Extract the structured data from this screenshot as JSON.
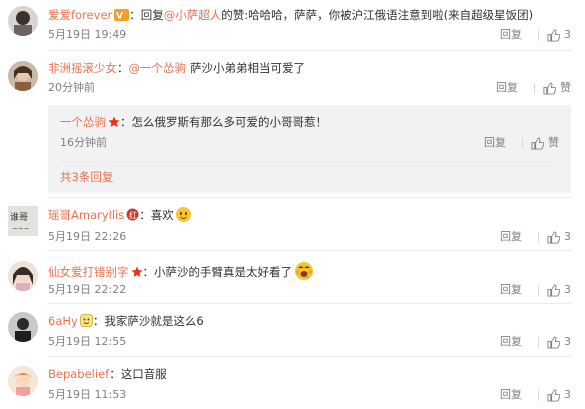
{
  "comments": [
    {
      "username": "爱爱forever",
      "badge": "vip-badge",
      "prefix": "：回复",
      "mention": "@小萨超人",
      "rest": "的赞:哈哈哈，萨萨，你被沪江俄语注意到啦",
      "source": "(来自超级星饭团)",
      "time": "5月19日 19:49",
      "reply_label": "回复",
      "like_count": "3"
    },
    {
      "username": "非洲摇滚少女",
      "prefix": "：",
      "mention": "@一个怂驹",
      "rest": "萨沙小弟弟相当可爱了",
      "time": "20分钟前",
      "reply_label": "回复",
      "like_label": "赞",
      "sub_reply": {
        "username": "一个怂驹",
        "badge": "star-badge",
        "text": "：怎么俄罗斯有那么多可爱的小哥哥惹！",
        "time": "16分钟前",
        "reply_label": "回复",
        "like_label": "赞",
        "more_link": "共3条回复"
      }
    },
    {
      "username": "瑶哥Amaryllis",
      "badge": "red-badge",
      "text": "：喜欢",
      "emoji": "smile-emoji",
      "time": "5月19日 22:26",
      "reply_label": "回复",
      "like_count": "3"
    },
    {
      "username": "仙女爱打错别字",
      "badge": "star-badge",
      "text": "：小萨沙的手臂真是太好看了",
      "emoji": "drool-emoji",
      "time": "5月19日 22:22",
      "reply_label": "回复",
      "like_count": "3"
    },
    {
      "username": "6aHy",
      "badge": "face-badge",
      "text": "：我家萨沙就是这么6",
      "time": "5月19日 12:55",
      "reply_label": "回复",
      "like_count": "3"
    },
    {
      "username": "Bepabelief",
      "text": "：这口音服",
      "time": "5月19日 11:53",
      "reply_label": "回复",
      "like_count": "3"
    }
  ]
}
